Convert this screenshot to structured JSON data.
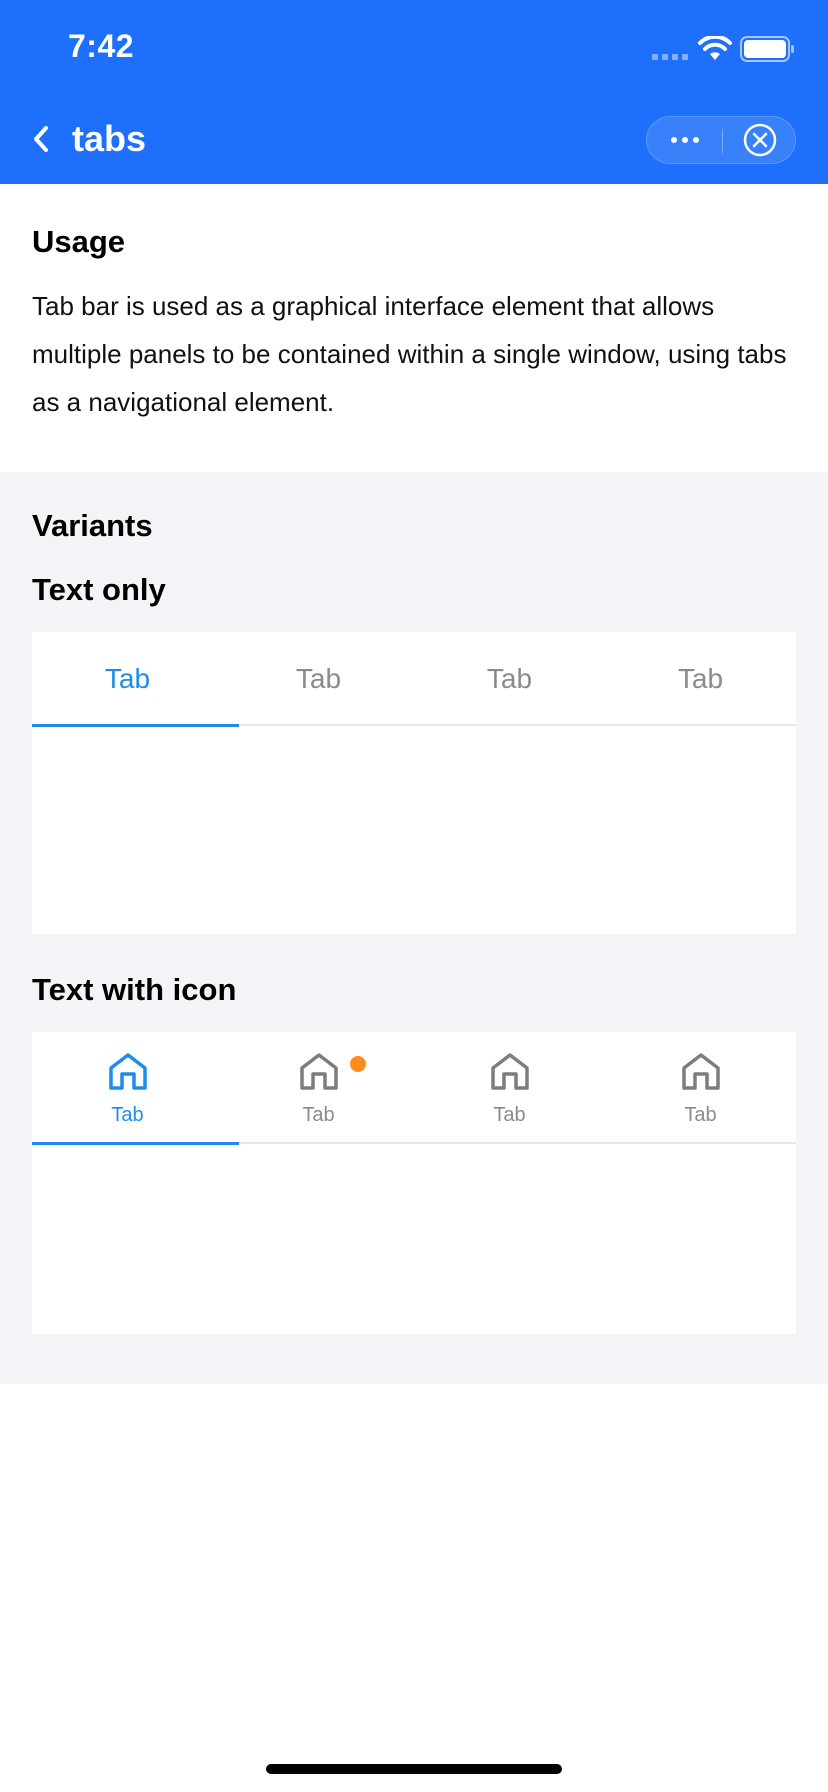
{
  "status_bar": {
    "time": "7:42"
  },
  "nav": {
    "title": "tabs",
    "icons": [
      "back-chevron-icon",
      "more-dots-icon",
      "close-circle-icon"
    ]
  },
  "usage": {
    "title": "Usage",
    "text": "Tab bar is used as a graphical interface element that allows multiple panels to be contained within a single window, using tabs as a navigational element."
  },
  "variants": {
    "title": "Variants",
    "text_only": {
      "title": "Text only",
      "tabs": [
        {
          "label": "Tab",
          "active": true
        },
        {
          "label": "Tab",
          "active": false
        },
        {
          "label": "Tab",
          "active": false
        },
        {
          "label": "Tab",
          "active": false
        }
      ]
    },
    "text_with_icon": {
      "title": "Text with icon",
      "tabs": [
        {
          "label": "Tab",
          "icon": "home-icon",
          "active": true,
          "badge_dot": false
        },
        {
          "label": "Tab",
          "icon": "home-icon",
          "active": false,
          "badge_dot": true
        },
        {
          "label": "Tab",
          "icon": "home-icon",
          "active": false,
          "badge_dot": false
        },
        {
          "label": "Tab",
          "icon": "home-icon",
          "active": false,
          "badge_dot": false
        }
      ]
    }
  },
  "colors": {
    "header": "#1E6FFB",
    "active_tab": "#1F8BEB",
    "inactive_tab": "#8A8A90",
    "badge_dot": "#FF8A1E",
    "section_bg": "#F4F4F8"
  }
}
